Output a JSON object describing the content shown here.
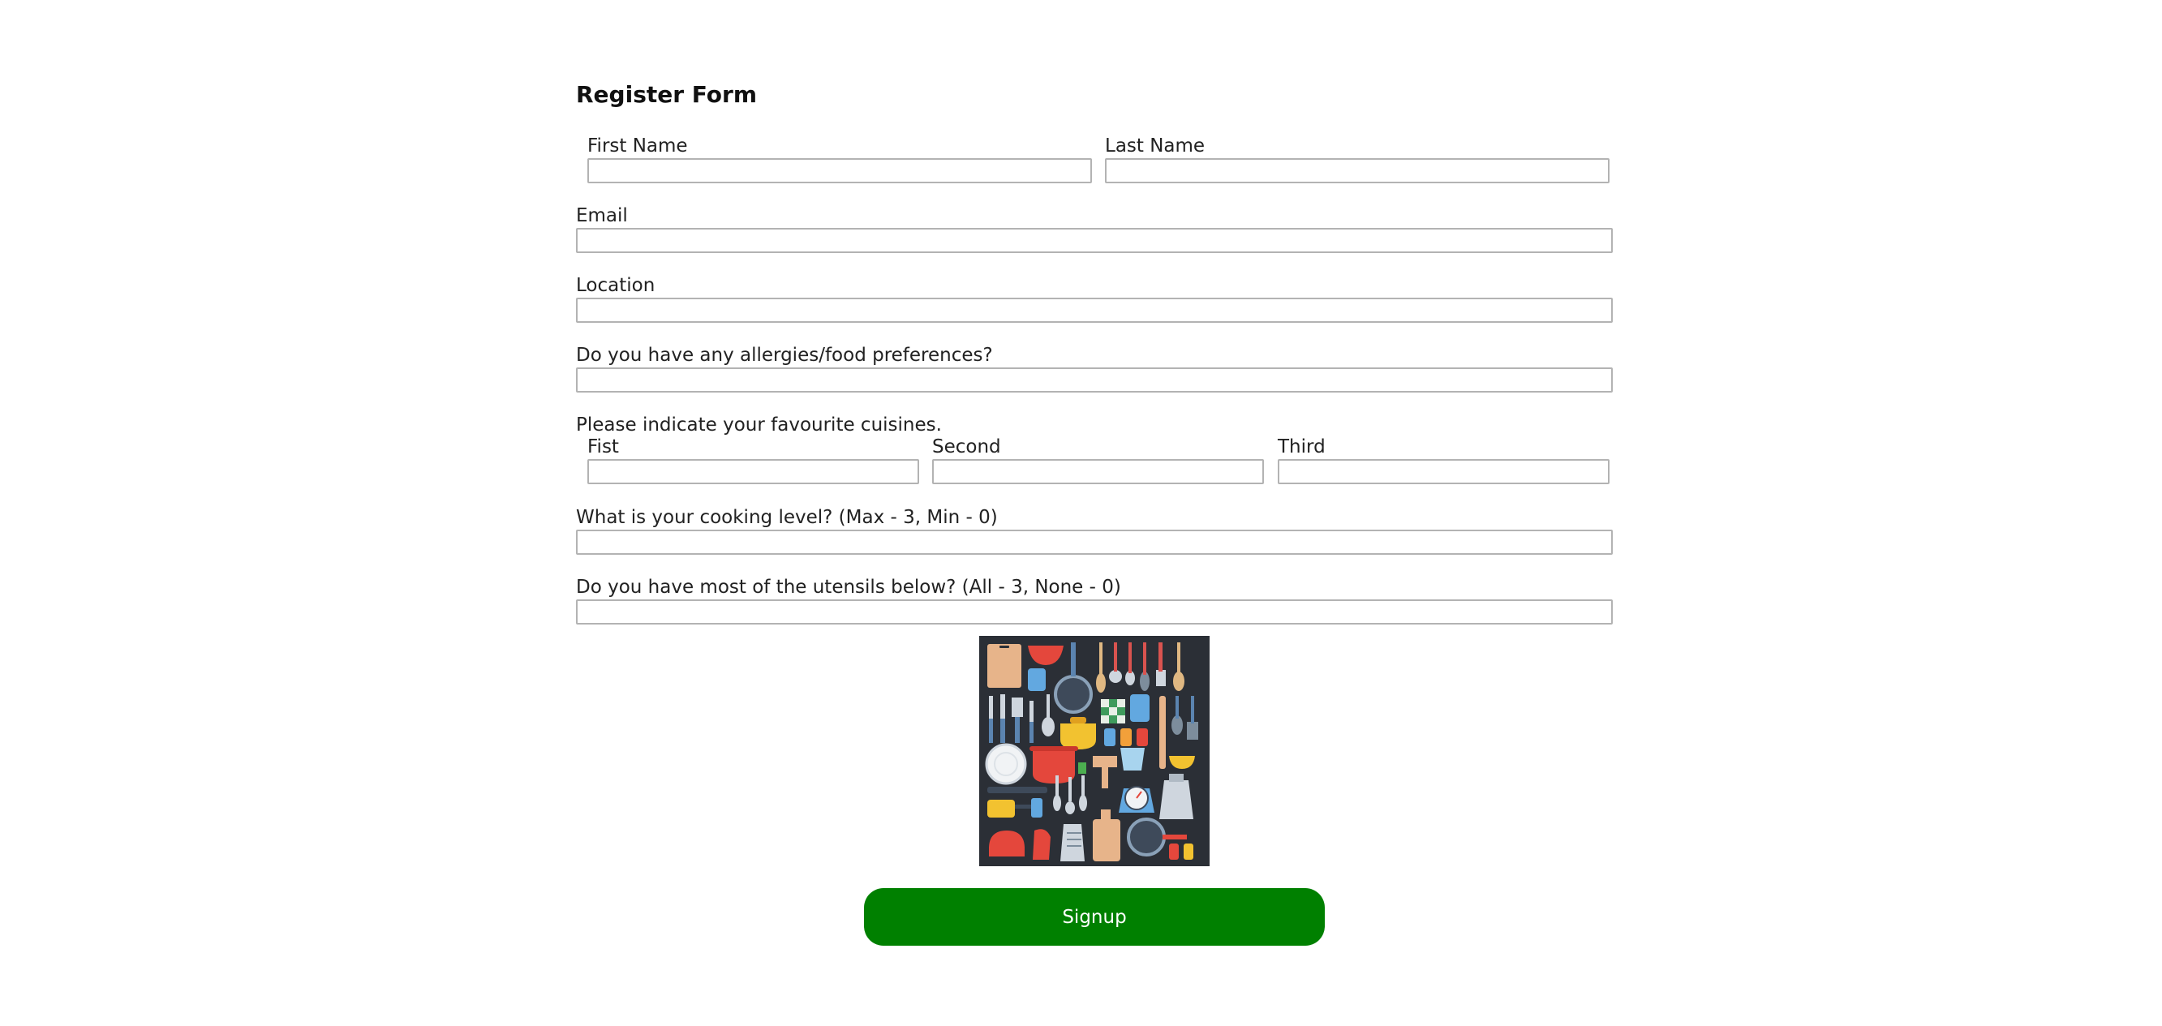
{
  "form": {
    "title": "Register Form",
    "first_name_label": "First Name",
    "last_name_label": "Last Name",
    "email_label": "Email",
    "location_label": "Location",
    "allergies_label": "Do you have any allergies/food preferences?",
    "cuisines_label": "Please indicate your favourite cuisines.",
    "cuisine_first_label": "Fist",
    "cuisine_second_label": "Second",
    "cuisine_third_label": "Third",
    "cooking_level_label": "What is your cooking level? (Max - 3, Min - 0)",
    "utensils_label": "Do you have most of the utensils below? (All - 3, None - 0)",
    "first_name_value": "",
    "last_name_value": "",
    "email_value": "",
    "location_value": "",
    "allergies_value": "",
    "cuisine_first_value": "",
    "cuisine_second_value": "",
    "cuisine_third_value": "",
    "cooking_level_value": "",
    "utensils_value": "",
    "signup_label": "Signup"
  },
  "colors": {
    "signup_button": "#008000",
    "utensils_background": "#2b2f36"
  }
}
